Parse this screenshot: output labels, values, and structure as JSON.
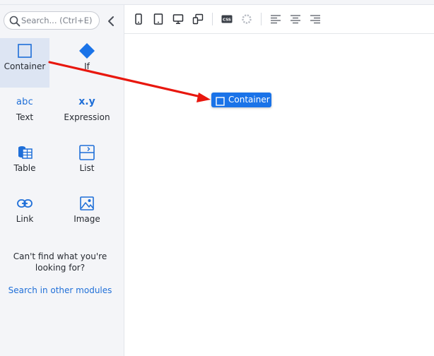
{
  "search": {
    "placeholder": "Search... (Ctrl+E)",
    "value": ""
  },
  "widgets": [
    {
      "label": "Container",
      "icon": "container-icon"
    },
    {
      "label": "If",
      "icon": "if-diamond-icon"
    },
    {
      "label": "Text",
      "icon": "text-abc-icon",
      "glyph": "abc"
    },
    {
      "label": "Expression",
      "icon": "expression-icon",
      "glyph": "x.y"
    },
    {
      "label": "Table",
      "icon": "table-icon"
    },
    {
      "label": "List",
      "icon": "list-icon"
    },
    {
      "label": "Link",
      "icon": "link-icon"
    },
    {
      "label": "Image",
      "icon": "image-icon"
    }
  ],
  "help": {
    "cant_find": "Can't find what you're looking for?",
    "search_other": "Search in other modules"
  },
  "toolbar": {
    "buttons": [
      "phone-icon",
      "tablet-icon",
      "desktop-icon",
      "responsive-icon",
      "css-icon",
      "loading-icon",
      "align-left-icon",
      "align-center-icon",
      "align-right-icon"
    ],
    "css_label": "CSS"
  },
  "drag_chip": {
    "label": "Container"
  },
  "colors": {
    "accent": "#1a73e8",
    "arrow": "#e8170e",
    "sidebar_bg": "#f4f5f8",
    "selected_bg": "#dde5f3"
  }
}
